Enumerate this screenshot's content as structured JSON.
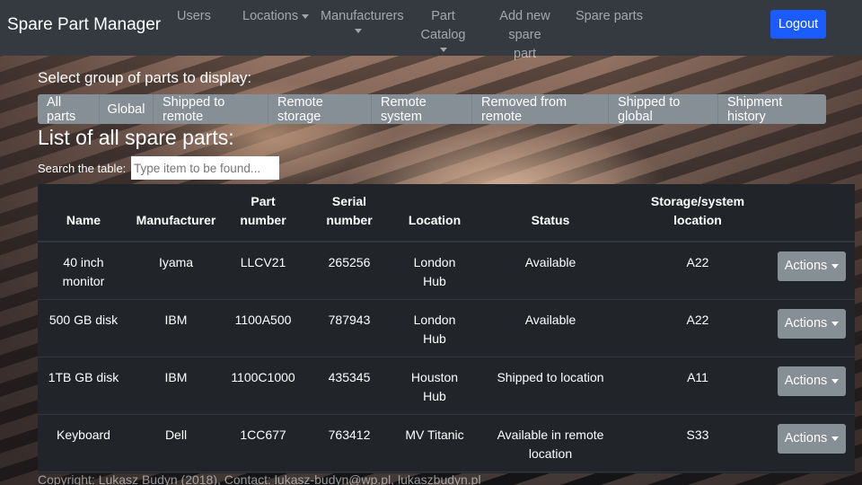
{
  "navbar": {
    "brand": "Spare Part Manager",
    "items": [
      {
        "label": "Users"
      },
      {
        "label": "Locations"
      },
      {
        "label": "Manufacturers"
      },
      {
        "label": "Part Catalog"
      },
      {
        "label_line1": "Add new",
        "label_line2": "spare part"
      },
      {
        "label": "Spare parts"
      }
    ],
    "logout_label": "Logout"
  },
  "filters": {
    "heading": "Select group of parts to display:",
    "buttons": [
      "All parts",
      "Global",
      "Shipped to remote",
      "Remote storage",
      "Remote system",
      "Removed from remote",
      "Shipped to global",
      "Shipment history"
    ]
  },
  "list": {
    "title": "List of all spare parts:",
    "search_label": "Search the table:",
    "search_placeholder": "Type item to be found..."
  },
  "table": {
    "headers": {
      "name": "Name",
      "manufacturer": "Manufacturer",
      "part_number_1": "Part",
      "part_number_2": "number",
      "serial_number_1": "Serial",
      "serial_number_2": "number",
      "location": "Location",
      "status": "Status",
      "storage_1": "Storage/system",
      "storage_2": "location"
    },
    "actions_label": "Actions",
    "rows": [
      {
        "name_1": "40 inch",
        "name_2": "monitor",
        "manufacturer": "Iyama",
        "part_number": "LLCV21",
        "serial_number": "265256",
        "location_1": "London",
        "location_2": "Hub",
        "status_1": "Available",
        "status_2": "",
        "storage": "A22"
      },
      {
        "name_1": "500 GB disk",
        "name_2": "",
        "manufacturer": "IBM",
        "part_number": "1100A500",
        "serial_number": "787943",
        "location_1": "London",
        "location_2": "Hub",
        "status_1": "Available",
        "status_2": "",
        "storage": "A22"
      },
      {
        "name_1": "1TB GB disk",
        "name_2": "",
        "manufacturer": "IBM",
        "part_number": "1100C1000",
        "serial_number": "435345",
        "location_1": "Houston",
        "location_2": "Hub",
        "status_1": "Shipped to location",
        "status_2": "",
        "storage": "A11"
      },
      {
        "name_1": "Keyboard",
        "name_2": "",
        "manufacturer": "Dell",
        "part_number": "1CC677",
        "serial_number": "763412",
        "location_1": "MV Titanic",
        "location_2": "",
        "status_1": "Available in remote",
        "status_2": "location",
        "storage": "S33"
      }
    ]
  },
  "footer": {
    "text": "Copyright: Lukasz Budyn (2018), Contact: lukasz-budyn@wp.pl, lukaszbudyn.pl"
  }
}
